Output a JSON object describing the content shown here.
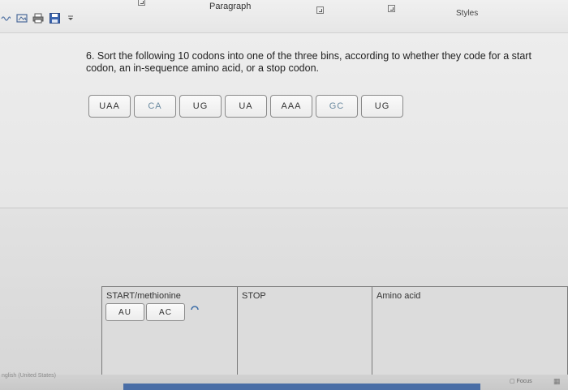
{
  "ribbon": {
    "paragraph_label": "Paragraph",
    "styles_label": "Styles"
  },
  "quick_access": {
    "icons": [
      "wave-icon",
      "crop-icon",
      "save-icon",
      "dropdown-icon"
    ]
  },
  "question": {
    "text": "6. Sort the following 10 codons into one of the three bins, according to whether they code for a start codon, an in-sequence amino acid, or a stop codon."
  },
  "codons": [
    {
      "label": "UAA"
    },
    {
      "label": "CA"
    },
    {
      "label": "UG"
    },
    {
      "label": "UA"
    },
    {
      "label": "AAA"
    },
    {
      "label": "GC"
    },
    {
      "label": "UG"
    }
  ],
  "bins": {
    "start": {
      "label": "START/methionine",
      "items": [
        {
          "label": "AU"
        },
        {
          "label": "AC"
        }
      ]
    },
    "stop": {
      "label": "STOP"
    },
    "amino": {
      "label": "Amino acid"
    }
  },
  "status": {
    "left_text": "nglish (United States)",
    "focus_label": "Focus"
  }
}
